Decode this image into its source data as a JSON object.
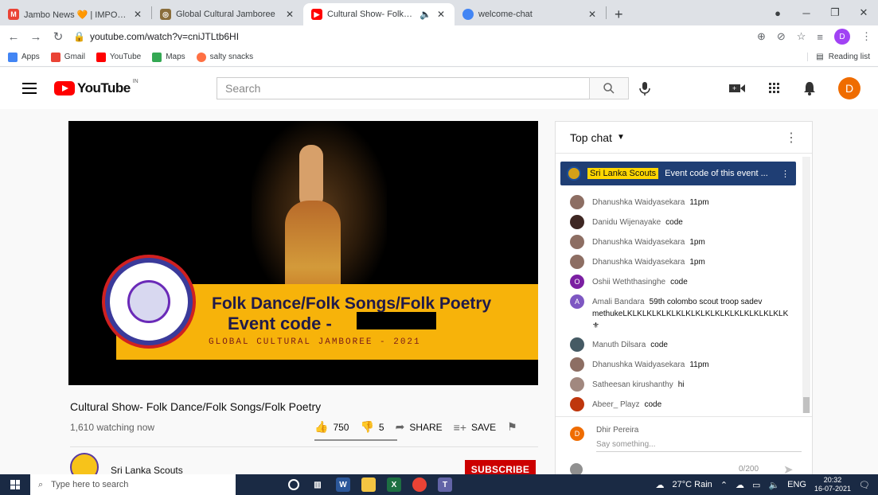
{
  "browser": {
    "tabs": [
      {
        "title": "Jambo News 🧡 | IMPORTANT! - ",
        "fav_color": "#ea4335",
        "fav_glyph": "M",
        "active": false
      },
      {
        "title": "Global Cultural Jamboree",
        "fav_color": "#8a6d3b",
        "fav_glyph": "◎",
        "active": false
      },
      {
        "title": "Cultural Show- Folk Dance/F",
        "fav_color": "#ff0000",
        "fav_glyph": "▶",
        "active": true
      },
      {
        "title": "welcome-chat",
        "fav_color": "#4285f4",
        "fav_glyph": "●",
        "active": false
      }
    ],
    "new_tab": "+",
    "url": "youtube.com/watch?v=cniJTLtb6HI",
    "profile_initial": "D",
    "bookmarks": [
      {
        "label": "Apps",
        "color": "#4285f4"
      },
      {
        "label": "Gmail",
        "color": "#ea4335"
      },
      {
        "label": "YouTube",
        "color": "#ff0000"
      },
      {
        "label": "Maps",
        "color": "#34a853"
      },
      {
        "label": "salty snacks",
        "color": "#ff7043"
      }
    ],
    "reading_list": "Reading list"
  },
  "masthead": {
    "logo_word": "YouTube",
    "country": "IN",
    "search_placeholder": "Search",
    "avatar_initial": "D"
  },
  "video": {
    "banner_line1": "Folk Dance/Folk Songs/Folk Poetry",
    "banner_line2": "Event code  -",
    "banner_line3": "GLOBAL CULTURAL JAMBOREE - 2021",
    "title": "Cultural Show- Folk Dance/Folk Songs/Folk Poetry",
    "watching": "1,610 watching now",
    "likes": "750",
    "dislikes": "5",
    "share_label": "SHARE",
    "save_label": "SAVE",
    "channel_name": "Sri Lanka Scouts",
    "subscribe_label": "SUBSCRIBE"
  },
  "chat": {
    "header": "Top chat",
    "pinned": {
      "author": "Sri Lanka Scouts",
      "text": "Event code of this event ..."
    },
    "messages": [
      {
        "author": "Dhanushka Waidyasekara",
        "text": "11pm",
        "color": "#8d6e63",
        "initial": ""
      },
      {
        "author": "Danidu Wijenayake",
        "text": "code",
        "color": "#3e2723",
        "initial": ""
      },
      {
        "author": "Dhanushka Waidyasekara",
        "text": "1pm",
        "color": "#8d6e63",
        "initial": ""
      },
      {
        "author": "Dhanushka Waidyasekara",
        "text": "1pm",
        "color": "#8d6e63",
        "initial": ""
      },
      {
        "author": "Oshii Weththasinghe",
        "text": "code",
        "color": "#7b1fa2",
        "initial": "O"
      },
      {
        "author": "Amali Bandara",
        "text": "59th colombo scout troop sadev methukeLKLKLKLKLKLKLKLKLKLKLKLKLKLKLKLKLK ⚜",
        "color": "#7e57c2",
        "initial": "A"
      },
      {
        "author": "Manuth Dilsara",
        "text": "code",
        "color": "#455a64",
        "initial": ""
      },
      {
        "author": "Dhanushka Waidyasekara",
        "text": "11pm",
        "color": "#8d6e63",
        "initial": ""
      },
      {
        "author": "Satheesan kirushanthy",
        "text": "hi",
        "color": "#a1887f",
        "initial": ""
      },
      {
        "author": "Abeer_ Playz",
        "text": "code",
        "color": "#bf360c",
        "initial": ""
      }
    ],
    "me_name": "Dhir Pereira",
    "me_initial": "D",
    "input_placeholder": "Say something...",
    "counter": "0/200"
  },
  "taskbar": {
    "search_placeholder": "Type here to search",
    "weather": "27°C  Rain",
    "lang": "ENG",
    "time": "20:32",
    "date": "16-07-2021"
  }
}
